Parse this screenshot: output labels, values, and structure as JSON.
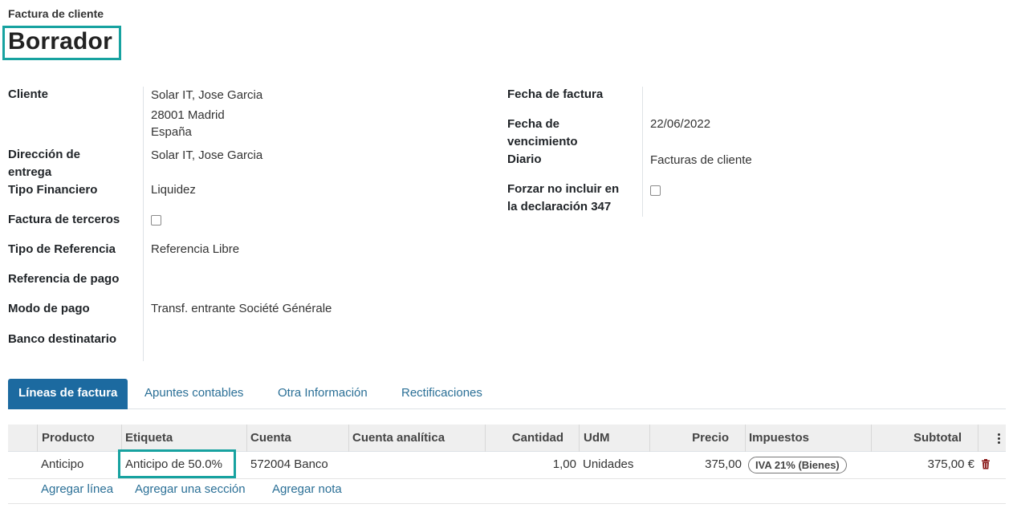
{
  "header": {
    "subtitle": "Factura de cliente",
    "state_title": "Borrador"
  },
  "left_fields": {
    "cliente_label": "Cliente",
    "cliente_name": "Solar IT, Jose Garcia",
    "cliente_addr1": "28001 Madrid",
    "cliente_addr2": "España",
    "entrega_label_1": "Dirección de",
    "entrega_label_2": "entrega",
    "entrega_value": "Solar IT, Jose Garcia",
    "tipo_financiero_label": "Tipo Financiero",
    "tipo_financiero_value": "Liquidez",
    "terceros_label": "Factura de terceros",
    "terceros_checked": false,
    "tipo_ref_label": "Tipo de Referencia",
    "tipo_ref_value": "Referencia Libre",
    "ref_pago_label": "Referencia de pago",
    "ref_pago_value": "",
    "modo_pago_label": "Modo de pago",
    "modo_pago_value": "Transf. entrante Société Générale",
    "banco_label": "Banco destinatario",
    "banco_value": ""
  },
  "right_fields": {
    "fecha_factura_label": "Fecha de factura",
    "fecha_factura_value": "",
    "vencimiento_label_1": "Fecha de",
    "vencimiento_label_2": "vencimiento",
    "vencimiento_value": "22/06/2022",
    "diario_label": "Diario",
    "diario_value": "Facturas de cliente",
    "forzar_label_1": "Forzar no incluir en",
    "forzar_label_2": "la declaración 347",
    "forzar_checked": false
  },
  "tabs": [
    {
      "label": "Líneas de factura",
      "active": true
    },
    {
      "label": "Apuntes contables",
      "active": false
    },
    {
      "label": "Otra Información",
      "active": false
    },
    {
      "label": "Rectificaciones",
      "active": false
    }
  ],
  "table": {
    "columns": [
      "Producto",
      "Etiqueta",
      "Cuenta",
      "Cuenta analítica",
      "Cantidad",
      "UdM",
      "Precio",
      "Impuestos",
      "Subtotal"
    ],
    "rows": [
      {
        "producto": "Anticipo",
        "etiqueta": "Anticipo de 50.0%",
        "cuenta": "572004 Banco",
        "cuenta_analitica": "",
        "cantidad": "1,00",
        "udm": "Unidades",
        "precio": "375,00",
        "impuestos": "IVA 21% (Bienes)",
        "subtotal": "375,00 €"
      }
    ],
    "add_links": [
      "Agregar línea",
      "Agregar una sección",
      "Agregar nota"
    ]
  },
  "colors": {
    "accent": "#1c6aa0",
    "link": "#2a6f96",
    "highlight": "#17a2a0"
  }
}
